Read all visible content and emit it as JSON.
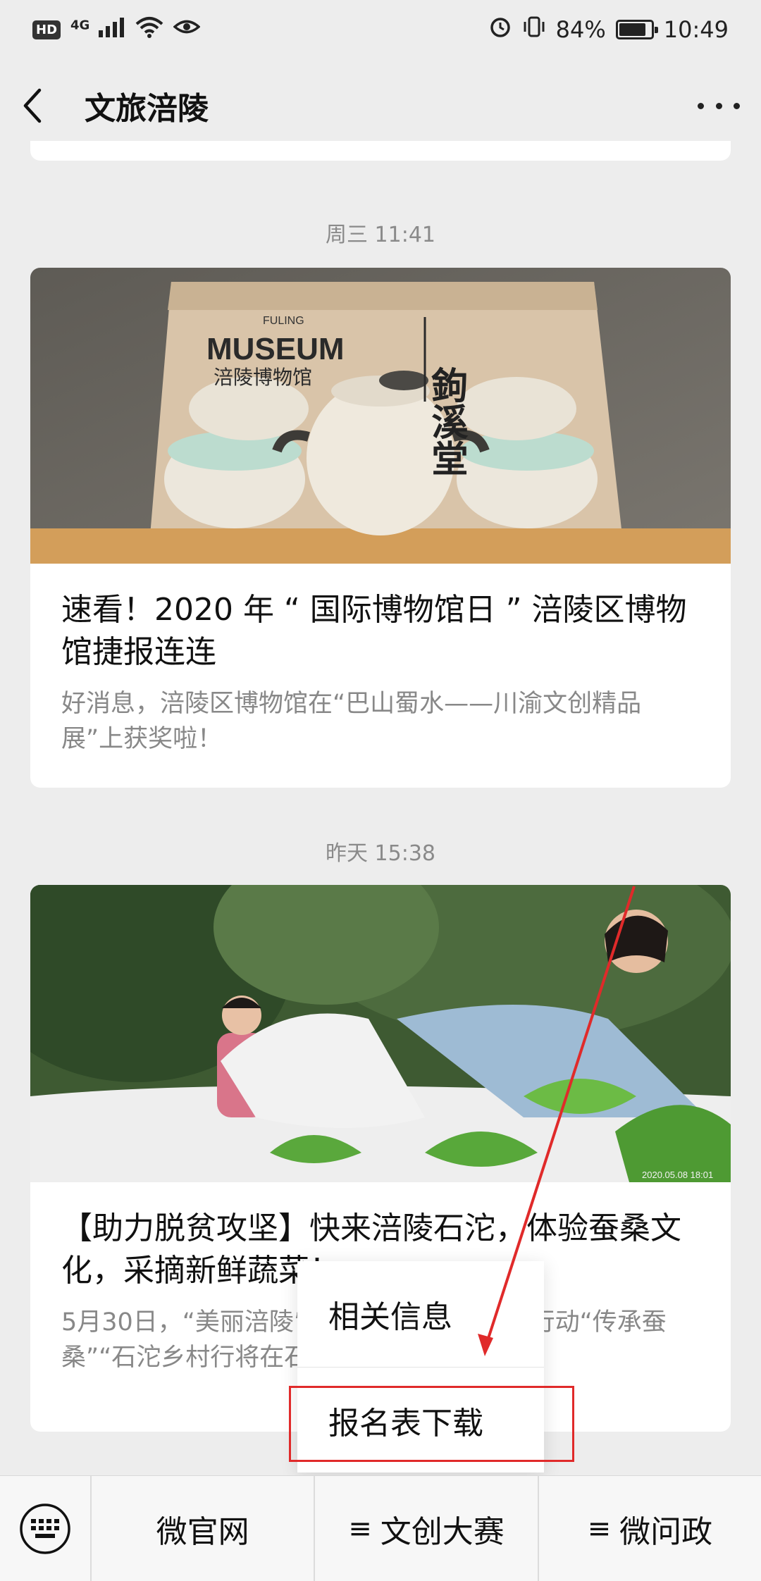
{
  "status_bar": {
    "hd": "HD",
    "network": "4G",
    "battery": "84%",
    "battery_level": 0.84,
    "time": "10:49"
  },
  "header": {
    "title": "文旅涪陵"
  },
  "feed": [
    {
      "timestamp": "周三 11:41",
      "cover_text_main": "MUSEUM",
      "cover_text_top": "FULING",
      "cover_text_cn": "涪陵博物馆",
      "cover_text_vertical": "鉤溪堂",
      "title": "速看！2020 年 “ 国际博物馆日 ” 涪陵区博物馆捷报连连",
      "digest": "好消息，涪陵区博物馆在“巴山蜀水——川渝文创精品展”上获奖啦！"
    },
    {
      "timestamp": "昨天 15:38",
      "cover_caption": "2020.05.08 18:01",
      "title": "【助力脱贫攻坚】快来涪陵石沱，体验蚕桑文化，采摘新鲜蔬菜！",
      "digest": "5月30日，“美丽涪陵”“脱贫”“十个一”专项行动“传承蚕桑”“石沱乡村行将在石沱镇光明村正"
    }
  ],
  "popup_menu": {
    "items": [
      "相关信息",
      "报名表下载"
    ]
  },
  "bottom_menu": {
    "tabs": [
      {
        "label": "微官网",
        "icon": ""
      },
      {
        "label": "文创大赛",
        "icon": "≡"
      },
      {
        "label": "微问政",
        "icon": "≡"
      }
    ]
  },
  "colors": {
    "annotation": "#e02a2a",
    "background": "#ededed"
  }
}
